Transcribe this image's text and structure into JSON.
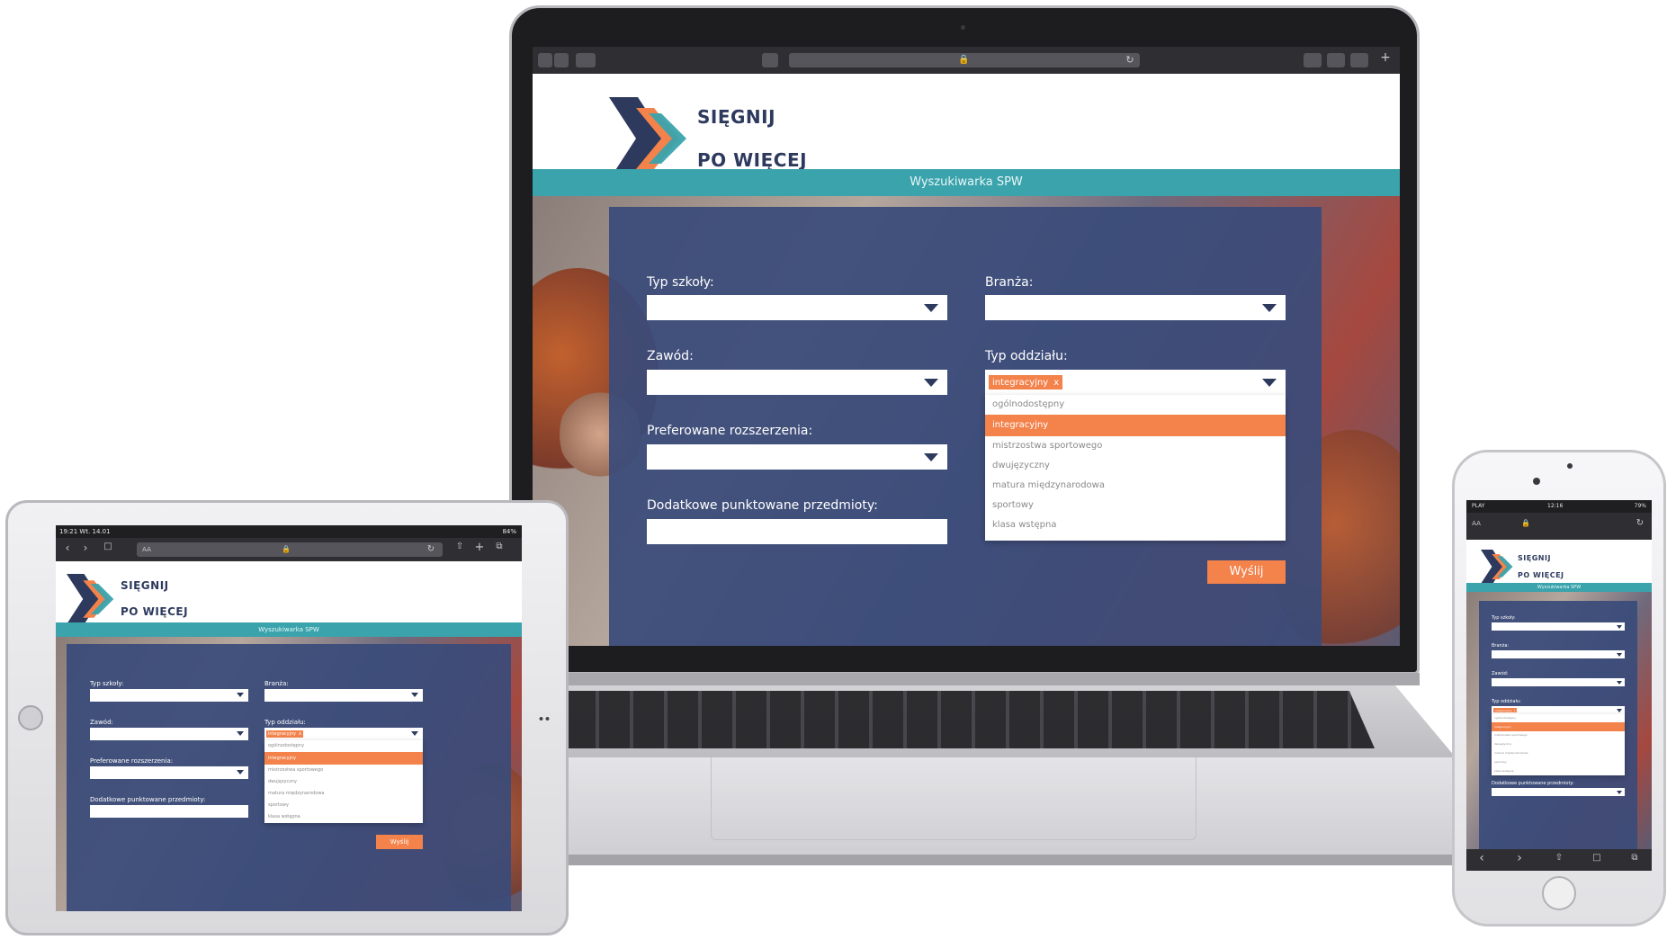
{
  "site": {
    "logo_line1": "SIĘGNIJ",
    "logo_line2": "PO WIĘCEJ",
    "nav_title": "Wyszukiwarka SPW",
    "form": {
      "typ_szkoly_label": "Typ szkoły:",
      "branza_label": "Branża:",
      "zawod_label": "Zawód:",
      "typ_oddzialu_label": "Typ oddziału:",
      "preferowane_label": "Preferowane rozszerzenia:",
      "dodatkowe_label": "Dodatkowe punktowane przedmioty:",
      "selected_tag": "integracyjny",
      "tag_remove": "x",
      "options": [
        {
          "label": "ogólnodostępny",
          "active": false
        },
        {
          "label": "integracyjny",
          "active": true
        },
        {
          "label": "mistrzostwa sportowego",
          "active": false
        },
        {
          "label": "dwujęzyczny",
          "active": false
        },
        {
          "label": "matura międzynarodowa",
          "active": false
        },
        {
          "label": "sportowy",
          "active": false
        },
        {
          "label": "klasa wstępna",
          "active": false
        }
      ],
      "submit_label": "Wyślij"
    }
  },
  "tablet_status": {
    "time": "19:21  Wt. 14.01",
    "battery": "84%"
  },
  "tablet_browser": {
    "text_size": "AA"
  },
  "phone_status": {
    "carrier": "PLAY",
    "time": "12:16",
    "battery": "79%"
  },
  "phone_browser": {
    "text_size": "AA"
  },
  "colors": {
    "accent": "#f3824b",
    "teal": "#3aa3ac",
    "panel": "#3a4b7a",
    "brand_navy": "#2d3a5e"
  }
}
